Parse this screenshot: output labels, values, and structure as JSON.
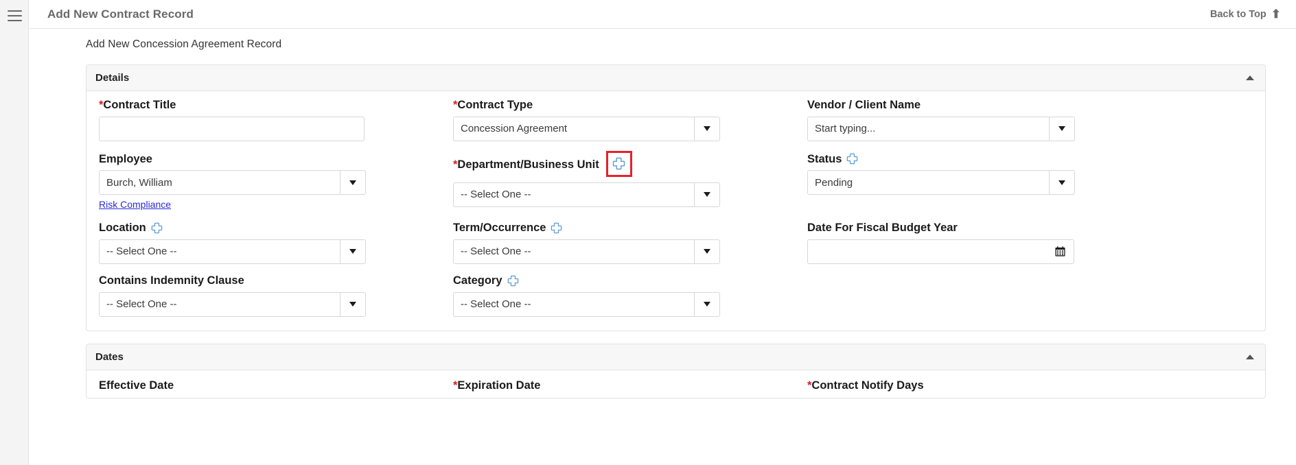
{
  "topbar": {
    "title": "Add New Contract Record",
    "back_to_top_label": "Back to Top",
    "back_to_top_icon": "arrow-up-icon",
    "menu_icon": "hamburger-menu-icon"
  },
  "page": {
    "subtitle": "Add New Concession Agreement Record"
  },
  "colors": {
    "required_asterisk": "#e01b1b",
    "highlight_box": "#e8202a",
    "plus_icon": "#5b9bd5",
    "link": "#2a2ad8",
    "panel_header_bg": "#f7f7f7"
  },
  "panels": [
    {
      "title": "Details",
      "collapse_icon": "caret-up-icon"
    },
    {
      "title": "Dates",
      "collapse_icon": "caret-up-icon"
    }
  ],
  "details": {
    "contract_title": {
      "label": "Contract Title",
      "required": true,
      "value": "",
      "placeholder": ""
    },
    "contract_type": {
      "label": "Contract Type",
      "required": true,
      "value": "Concession Agreement"
    },
    "vendor_client_name": {
      "label": "Vendor / Client Name",
      "required": false,
      "value": "",
      "placeholder": "Start typing..."
    },
    "employee": {
      "label": "Employee",
      "required": false,
      "value": "Burch, William",
      "sublink": "Risk Compliance"
    },
    "department_business_unit": {
      "label": "Department/Business Unit",
      "required": true,
      "value": "-- Select One --",
      "add_icon": "plus-icon",
      "highlighted": true
    },
    "status": {
      "label": "Status",
      "required": false,
      "value": "Pending",
      "add_icon": "plus-icon"
    },
    "location": {
      "label": "Location",
      "required": false,
      "value": "-- Select One --",
      "add_icon": "plus-icon"
    },
    "term_occurrence": {
      "label": "Term/Occurrence",
      "required": false,
      "value": "-- Select One --",
      "add_icon": "plus-icon"
    },
    "date_for_fiscal_budget_year": {
      "label": "Date For Fiscal Budget Year",
      "required": false,
      "value": "",
      "calendar_icon": "calendar-icon"
    },
    "contains_indemnity_clause": {
      "label": "Contains Indemnity Clause",
      "required": false,
      "value": "-- Select One --"
    },
    "category": {
      "label": "Category",
      "required": false,
      "value": "-- Select One --",
      "add_icon": "plus-icon"
    }
  },
  "dates": {
    "effective_date": {
      "label": "Effective Date",
      "required": false
    },
    "expiration_date": {
      "label": "Expiration Date",
      "required": true
    },
    "contract_notify_days": {
      "label": "Contract Notify Days",
      "required": true
    }
  }
}
